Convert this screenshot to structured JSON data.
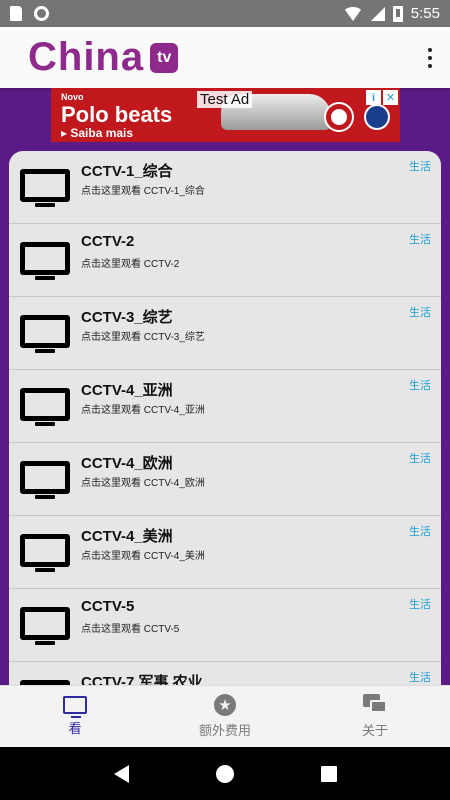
{
  "status_bar": {
    "time": "5:55"
  },
  "app": {
    "logo_text": "China",
    "logo_badge": "tv"
  },
  "ad": {
    "small_text": "Novo",
    "title": "Polo beats",
    "subtitle": "▸ Saiba mais",
    "label": "Test Ad",
    "info_glyph": "i",
    "close_glyph": "✕"
  },
  "channels": [
    {
      "title": "CCTV-1_综合",
      "subtitle": "点击这里观看 CCTV-1_综合",
      "tag": "生活"
    },
    {
      "title": "CCTV-2",
      "subtitle": "点击这里观看 CCTV-2",
      "tag": "生活"
    },
    {
      "title": "CCTV-3_综艺",
      "subtitle": "点击这里观看 CCTV-3_综艺",
      "tag": "生活"
    },
    {
      "title": "CCTV-4_亚洲",
      "subtitle": "点击这里观看 CCTV-4_亚洲",
      "tag": "生活"
    },
    {
      "title": "CCTV-4_欧洲",
      "subtitle": "点击这里观看 CCTV-4_欧洲",
      "tag": "生活"
    },
    {
      "title": "CCTV-4_美洲",
      "subtitle": "点击这里观看 CCTV-4_美洲",
      "tag": "生活"
    },
    {
      "title": "CCTV-5",
      "subtitle": "点击这里观看 CCTV-5",
      "tag": "生活"
    },
    {
      "title": "CCTV-7 军事 农业",
      "subtitle": "",
      "tag": "生活"
    }
  ],
  "bottom_nav": {
    "watch": {
      "label": "看",
      "icon": "tv-icon"
    },
    "extra_fees": {
      "label": "额外费用",
      "icon": "star-icon"
    },
    "about": {
      "label": "关于",
      "icon": "chat-icon"
    }
  },
  "colors": {
    "brand": "#8e2a8c",
    "background": "#5a1b86",
    "tag": "#1aa0d6",
    "nav_active": "#2f2aa0"
  }
}
